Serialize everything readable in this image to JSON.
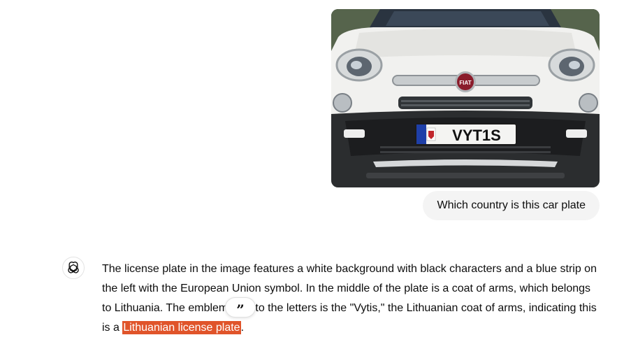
{
  "user_message": {
    "text": "Which country is this car plate",
    "image": {
      "plate_text": "VYT1S",
      "brand_badge_text": "FIAT"
    }
  },
  "assistant_message": {
    "text_before_highlight": "The license plate in the image features a white background with black characters and a blue strip on the left with the European Union symbol. In the middle of the plate is a coat of arms, which belongs to Lithuania. The emblem next to the letters is the \"Vytis,\" the Lithuanian coat of arms, indicating this is a ",
    "highlighted_text": "Lithuanian license plate",
    "text_after_highlight": "."
  },
  "quote_button": {
    "icon": "quote-icon",
    "glyph": "”"
  },
  "colors": {
    "user_bubble": "#f4f4f4",
    "highlight": "#e0542a",
    "text": "#0d0d0d"
  }
}
